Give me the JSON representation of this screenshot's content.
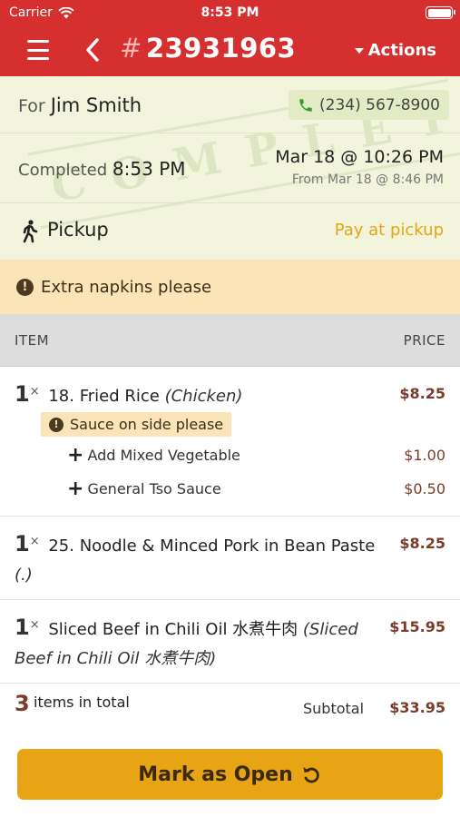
{
  "status_bar": {
    "carrier": "Carrier",
    "time": "8:53 PM",
    "icons": [
      "wifi-icon",
      "battery-icon"
    ]
  },
  "header": {
    "order_hash": "#",
    "order_number": "23931963",
    "actions_label": "Actions",
    "icons": [
      "menu-icon",
      "back-icon",
      "caret-down-icon"
    ]
  },
  "customer": {
    "for_label": "For",
    "name": "Jim Smith",
    "phone": "(234) 567-8900"
  },
  "status": {
    "completed_label": "Completed",
    "completed_time": "8:53 PM",
    "due_date": "Mar 18 @ 10:26 PM",
    "from_date": "From Mar 18 @ 8:46 PM",
    "watermark": "COMPLETED"
  },
  "fulfillment": {
    "type": "Pickup",
    "payment": "Pay at pickup"
  },
  "order_note": "Extra napkins please",
  "table": {
    "item_header": "ITEM",
    "price_header": "PRICE"
  },
  "items": [
    {
      "qty": "1",
      "x": "×",
      "name": "18. Fried Rice",
      "variant": "(Chicken)",
      "price": "$8.25",
      "note": "Sauce on side please",
      "modifiers": [
        {
          "label": "Add Mixed Vegetable",
          "price": "$1.00"
        },
        {
          "label": "General Tso Sauce",
          "price": "$0.50"
        }
      ]
    },
    {
      "qty": "1",
      "x": "×",
      "name": "25. Noodle & Minced Pork in Bean Paste",
      "variant": "(.)",
      "price": "$8.25"
    },
    {
      "qty": "1",
      "x": "×",
      "name": "Sliced Beef in Chili Oil 水煮牛肉",
      "variant": "(Sliced Beef in Chili Oil 水煮牛肉)",
      "price": "$15.95"
    }
  ],
  "summary": {
    "count": "3",
    "count_label": "items in total",
    "subtotal_label": "Subtotal",
    "subtotal_value": "$33.95"
  },
  "action_button": {
    "label": "Mark as Open",
    "icon": "undo-icon"
  },
  "colors": {
    "header": "#d62f2f",
    "info_bg": "#f2f5dc",
    "note_bg": "#fbe4b8",
    "accent": "#e7a515",
    "price": "#7a3b2a"
  }
}
